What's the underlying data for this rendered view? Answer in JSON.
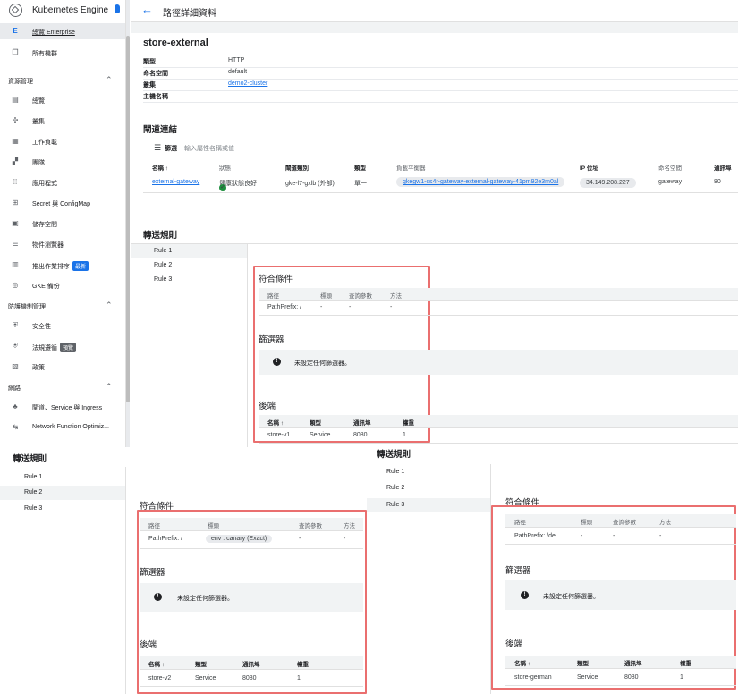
{
  "app": {
    "title": "Kubernetes Engine"
  },
  "sidebar": {
    "top_items": [
      {
        "icon": "E",
        "label": "總覽 Enterprise"
      },
      {
        "icon": "❐",
        "label": "所有機群"
      }
    ],
    "section1": "資源管理",
    "items1": [
      {
        "icon": "▤",
        "label": "總覽"
      },
      {
        "icon": "✣",
        "label": "叢集"
      },
      {
        "icon": "▦",
        "label": "工作負載"
      },
      {
        "icon": "▞",
        "label": "團隊"
      },
      {
        "icon": "⁞⁞",
        "label": "應用程式"
      },
      {
        "icon": "⊞",
        "label": "Secret 與 ConfigMap"
      },
      {
        "icon": "▣",
        "label": "儲存空間"
      },
      {
        "icon": "☰",
        "label": "物件瀏覽器"
      },
      {
        "icon": "▥",
        "label": "推出作業排序",
        "badge": "最新"
      },
      {
        "icon": "◎",
        "label": "GKE 備份"
      }
    ],
    "section2": "防護機制管理",
    "items2": [
      {
        "icon": "⛨",
        "label": "安全性"
      },
      {
        "icon": "⛨",
        "label": "法規遵循",
        "badge": "預覽"
      },
      {
        "icon": "▧",
        "label": "政策"
      }
    ],
    "section3": "網路",
    "items3": [
      {
        "icon": "♣",
        "label": "閘道、Service 與 Ingress"
      },
      {
        "icon": "↹",
        "label": "Network Function Optimiz..."
      }
    ]
  },
  "header": {
    "title": "路徑詳細資料"
  },
  "resource": {
    "name": "store-external",
    "details": [
      {
        "key": "類型",
        "value": "HTTP"
      },
      {
        "key": "命名空間",
        "value": "default"
      },
      {
        "key": "叢集",
        "value": "demo2-cluster"
      },
      {
        "key": "主機名稱",
        "value": ""
      }
    ]
  },
  "gateways": {
    "title": "閘道連結",
    "filter_label": "篩選",
    "filter_placeholder": "輸入屬性名稱或值",
    "columns": [
      "名稱 ↑",
      "狀態",
      "閘道類別",
      "類型",
      "負載平衡器",
      "IP 位址",
      "命名空間",
      "通訊埠"
    ],
    "row": {
      "name": "external-gateway",
      "status": "健康狀態良好",
      "class": "gke-l7-gxlb (外部)",
      "type": "單一",
      "lb": "gkegw1-cs4r-gateway-external-gateway-41pm92e3m0al",
      "ip": "34.149.208.227",
      "ns": "gateway",
      "port": "80"
    }
  },
  "routing": {
    "title": "轉送規則",
    "rules": [
      "Rule 1",
      "Rule 2",
      "Rule 3"
    ],
    "match_title": "符合條件",
    "filter_title": "篩選器",
    "backend_title": "後端",
    "match_cols": [
      "路徑",
      "標頭",
      "查詢參數",
      "方法"
    ],
    "backend_cols": [
      "名稱 ↑",
      "類型",
      "通訊埠",
      "權重"
    ],
    "no_filter": "未設定任何篩選器。",
    "panels": [
      {
        "path": "PathPrefix: /",
        "header": "-",
        "query": "-",
        "method": "-",
        "svc": "store-v1",
        "type": "Service",
        "port": "8080",
        "weight": "1"
      },
      {
        "path": "PathPrefix: /",
        "header": "env : canary (Exact)",
        "query": "-",
        "method": "-",
        "svc": "store-v2",
        "type": "Service",
        "port": "8080",
        "weight": "1"
      },
      {
        "path": "PathPrefix: /de",
        "header": "-",
        "query": "-",
        "method": "-",
        "svc": "store-german",
        "type": "Service",
        "port": "8080",
        "weight": "1"
      }
    ]
  }
}
